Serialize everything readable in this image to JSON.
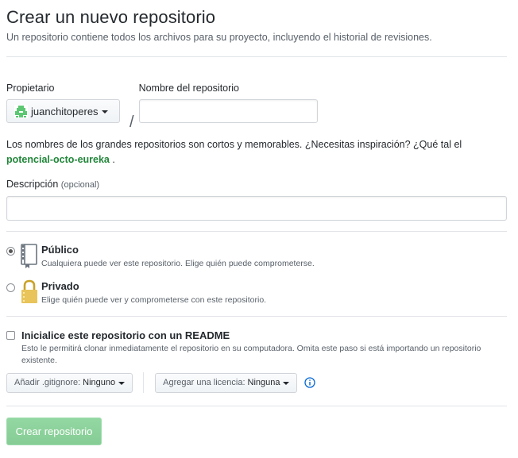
{
  "header": {
    "title": "Crear un nuevo repositorio",
    "subtitle": "Un repositorio contiene todos los archivos para su proyecto, incluyendo el historial de revisiones."
  },
  "owner": {
    "label": "Propietario",
    "value": "juanchitoperes",
    "avatar_icon": "identicon-avatar"
  },
  "separator_slash": "/",
  "repo_name": {
    "label": "Nombre del repositorio",
    "value": ""
  },
  "hint": {
    "text": "Los nombres de los grandes repositorios son cortos y memorables. ¿Necesitas inspiración? ¿Qué tal el ",
    "suggestion": "potencial-octo-eureka",
    "suffix": " ."
  },
  "description": {
    "label": "Descripción",
    "optional": "(opcional)",
    "value": ""
  },
  "visibility": {
    "options": [
      {
        "title": "Público",
        "description": "Cualquiera puede ver este repositorio. Elige quién puede comprometerse.",
        "icon": "repo-book-icon",
        "checked": true
      },
      {
        "title": "Privado",
        "description": "Elige quién puede ver y comprometerse con este repositorio.",
        "icon": "lock-icon",
        "checked": false
      }
    ]
  },
  "init_readme": {
    "title": "Inicialice este repositorio con un README",
    "description": "Esto le permitirá clonar inmediatamente el repositorio en su computadora. Omita este paso si está importando un repositorio existente.",
    "checked": false
  },
  "gitignore": {
    "label": "Añadir .gitignore:",
    "value": "Ninguno"
  },
  "license": {
    "label": "Agregar una licencia:",
    "value": "Ninguna"
  },
  "submit": {
    "label": "Crear repositorio"
  },
  "colors": {
    "suggestion": "#22863a",
    "submit_bg": "#8dd19c",
    "info": "#0366d6"
  }
}
